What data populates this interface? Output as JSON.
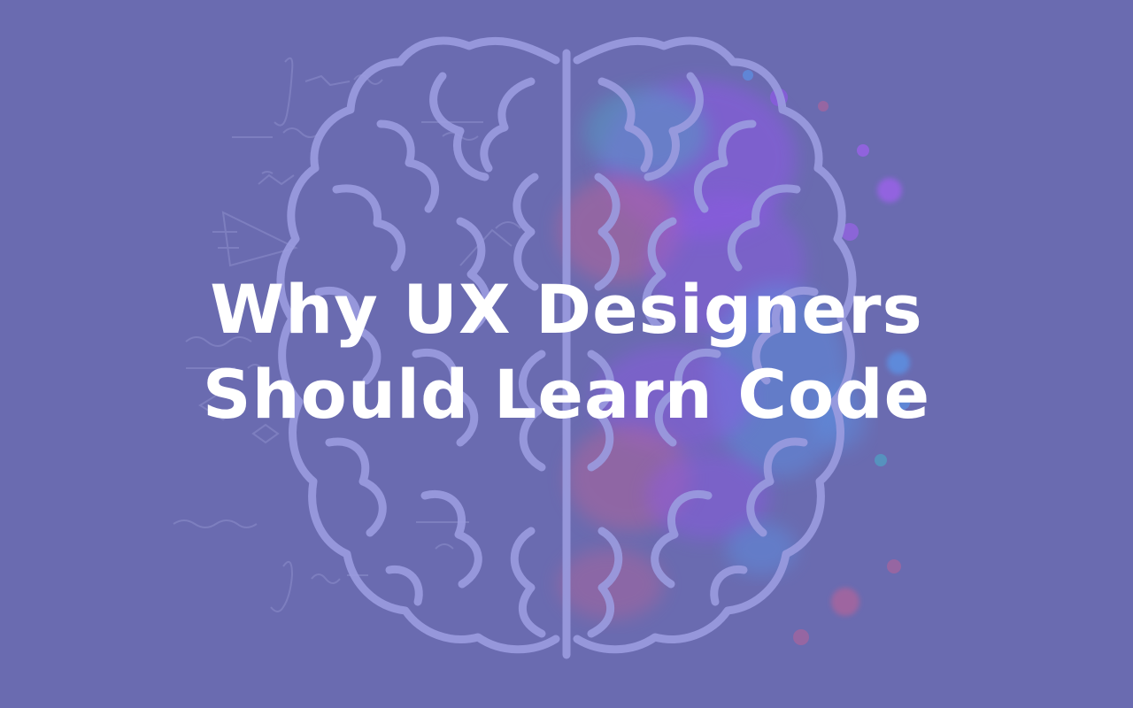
{
  "headline": {
    "line1": "Why UX Designers",
    "line2": "Should Learn Code"
  },
  "illustration": {
    "icon": "brain-icon",
    "colors": {
      "background": "#6a6bb0",
      "brain_outline": "#9b9ce0",
      "math_sketches": "#8485c4",
      "splatter_violet": "#8e58e6",
      "splatter_magenta": "#b4639a",
      "splatter_blue": "#5b92e5",
      "splatter_teal": "#4fa3c4"
    }
  }
}
